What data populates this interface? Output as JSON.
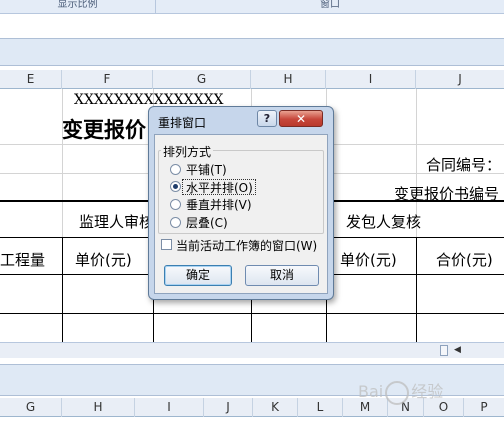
{
  "ribbon": {
    "group_display_ratio": "显示比例",
    "group_window": "窗口"
  },
  "sheet1": {
    "column_headers": [
      "E",
      "F",
      "G",
      "H",
      "I",
      "J"
    ],
    "cells": {
      "placeholder_x": "XXXXXXXXXXXXXXX",
      "title_partial": "变更报价",
      "contract_no": "合同编号：",
      "quote_no": "变更报价书编号",
      "supervisor_review": "监理人审核",
      "employer_review": "发包人复核",
      "quantity": "工程量",
      "unit_price_1": "单价(元)",
      "unit_price_2": "单价(元)",
      "total_price": "合价(元)"
    }
  },
  "sheet2": {
    "column_headers": [
      "G",
      "H",
      "I",
      "J",
      "K",
      "L",
      "M",
      "N",
      "O",
      "P"
    ]
  },
  "dialog": {
    "title": "重排窗口",
    "help_label": "?",
    "close_label": "✕",
    "group_label": "排列方式",
    "options": [
      {
        "label": "平铺(T)",
        "selected": false
      },
      {
        "label": "水平并排(O)",
        "selected": true
      },
      {
        "label": "垂直并排(V)",
        "selected": false
      },
      {
        "label": "层叠(C)",
        "selected": false
      }
    ],
    "checkbox_label": "当前活动工作簿的窗口(W)",
    "checkbox_checked": false,
    "ok_label": "确定",
    "cancel_label": "取消"
  },
  "watermark": {
    "brand": "Bai",
    "brand_cn": "经验"
  }
}
